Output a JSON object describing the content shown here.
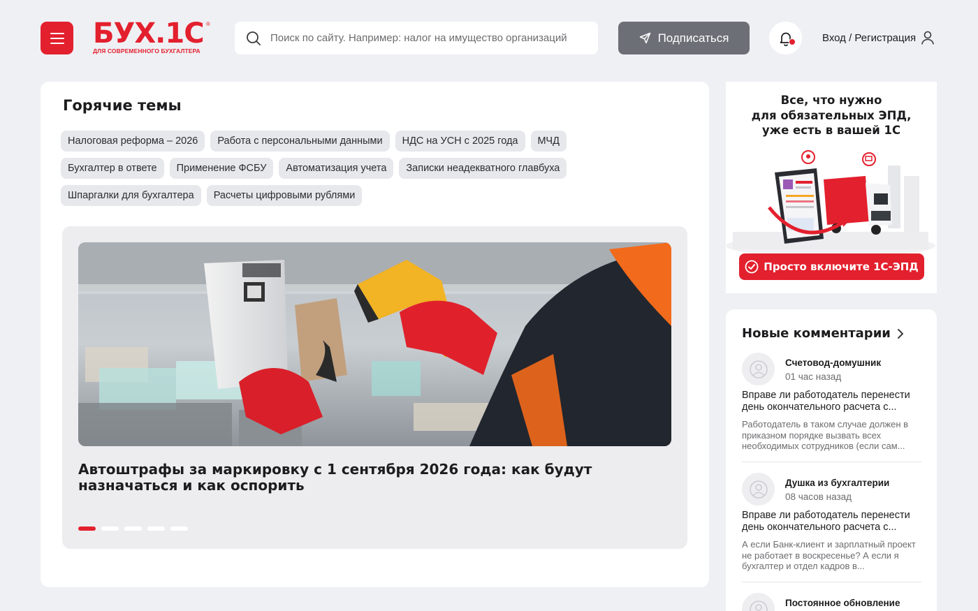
{
  "colors": {
    "brand": "#e3202e",
    "background": "#eff0f4",
    "subscribe_bg": "#6c6f76",
    "tag_bg": "#e7e8ec"
  },
  "header": {
    "menu_icon": "hamburger-menu-icon",
    "logo": {
      "main": "БУХ.1С",
      "tagline": "ДЛЯ СОВРЕМЕННОГО БУХГАЛТЕРА"
    },
    "search": {
      "icon": "search-icon",
      "placeholder": "Поиск по сайту. Например: налог на имущество организаций",
      "value": ""
    },
    "subscribe": {
      "icon": "send-icon",
      "label": "Подписаться"
    },
    "notifications": {
      "icon": "bell-icon",
      "has_unread": true
    },
    "login": {
      "label": "Вход / Регистрация",
      "icon": "user-icon"
    }
  },
  "hot_topics": {
    "title": "Горячие темы",
    "rows": [
      [
        "Налоговая реформа – 2026",
        "Работа с персональными данными",
        "НДС на УСН с 2025 года",
        "МЧД"
      ],
      [
        "Бухгалтер в ответе",
        "Применение ФСБУ",
        "Автоматизация учета",
        "Записки неадекватного главбуха"
      ],
      [
        "Шпаргалки для бухгалтера",
        "Расчеты цифровыми рублями"
      ]
    ]
  },
  "featured": {
    "title": "Автоштрафы за маркировку с 1 сентября 2026 года: как будут назначаться и как оспорить",
    "image": "worker-scanning-box-barcode-image",
    "slides_count": 5,
    "active_slide": 1
  },
  "ad": {
    "text": "Все, что нужно\nдля обязательных ЭПД,\nуже есть в вашей 1С",
    "button": "Просто включите 1С-ЭПД",
    "button_icon": "check-circle-icon",
    "image": "tablet-and-truck-illustration"
  },
  "comments": {
    "title": "Новые комментарии",
    "arrow_icon": "chevron-right-icon",
    "items": [
      {
        "author": "Счетовод-домушник",
        "time": "01 час назад",
        "question": "Вправе ли работодатель перенести день окончательного расчета с...",
        "answer": "Работодатель в таком случае должен в приказном порядке вызвать всех необходимых сотрудников (если сам..."
      },
      {
        "author": "Душка из бухгалтерии",
        "time": "08 часов назад",
        "question": "Вправе ли работодатель перенести день окончательного расчета с...",
        "answer": "А если Банк-клиент и зарплатный проект не работает в воскресенье? А если я бухгалтер и отдел кадров в..."
      },
      {
        "author": "Постоянное обновление",
        "time": "",
        "question": "",
        "answer": ""
      }
    ]
  }
}
